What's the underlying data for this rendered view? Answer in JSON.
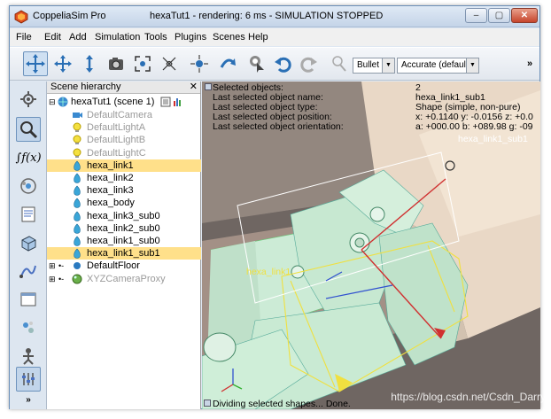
{
  "window": {
    "app_name": "CoppeliaSim Pro",
    "title": "hexaTut1 - rendering: 6 ms - SIMULATION STOPPED",
    "controls": [
      "–",
      "▢",
      "✕"
    ]
  },
  "menu": [
    "File",
    "Edit",
    "Add",
    "Simulation",
    "Tools",
    "Plugins",
    "Scenes",
    "Help"
  ],
  "toolbar": {
    "icons": [
      "object-shift-icon",
      "object-rotate-icon",
      "camera-pan-icon",
      "camera-snapshot-icon",
      "fit-view-icon",
      "camera-fly-icon",
      "assemble-icon",
      "transfer-dna-icon",
      "click-select-icon",
      "undo-icon",
      "redo-icon",
      "light-icon"
    ],
    "engine": "Bullet",
    "accuracy": "Accurate (default)",
    "overflow": "»"
  },
  "sidebar_icons": [
    "model-browser-icon",
    "scene-hierarchy-icon",
    "calculation-modules-icon",
    "collections-icon",
    "scripts-icon",
    "shapes-icon",
    "paths-icon",
    "views-icon",
    "page-selector-icon",
    "scene-selector-icon",
    "simulation-settings-icon",
    "more-icon"
  ],
  "hierarchy": {
    "title": "Scene hierarchy",
    "close": "✕",
    "scene": "hexaTut1 (scene 1)",
    "items": [
      {
        "label": "DefaultCamera",
        "icon": "camera-icon",
        "grey": true,
        "selected": false
      },
      {
        "label": "DefaultLightA",
        "icon": "light-bulb-icon",
        "grey": true,
        "selected": false
      },
      {
        "label": "DefaultLightB",
        "icon": "light-bulb-icon",
        "grey": true,
        "selected": false
      },
      {
        "label": "DefaultLightC",
        "icon": "light-bulb-icon",
        "grey": true,
        "selected": false
      },
      {
        "label": "hexa_link1",
        "icon": "shape-icon",
        "grey": false,
        "selected": true
      },
      {
        "label": "hexa_link2",
        "icon": "shape-icon",
        "grey": false,
        "selected": false
      },
      {
        "label": "hexa_link3",
        "icon": "shape-icon",
        "grey": false,
        "selected": false
      },
      {
        "label": "hexa_body",
        "icon": "shape-icon",
        "grey": false,
        "selected": false
      },
      {
        "label": "hexa_link3_sub0",
        "icon": "shape-icon",
        "grey": false,
        "selected": false
      },
      {
        "label": "hexa_link2_sub0",
        "icon": "shape-icon",
        "grey": false,
        "selected": false
      },
      {
        "label": "hexa_link1_sub0",
        "icon": "shape-icon",
        "grey": false,
        "selected": false
      },
      {
        "label": "hexa_link1_sub1",
        "icon": "shape-icon",
        "grey": false,
        "selected": true
      },
      {
        "label": "DefaultFloor",
        "icon": "dummy-icon",
        "grey": false,
        "selected": false
      },
      {
        "label": "XYZCameraProxy",
        "icon": "sphere-icon",
        "grey": true,
        "selected": false
      }
    ]
  },
  "info": {
    "labels": [
      "Selected objects:",
      "Last selected object name:",
      "Last selected object type:",
      "Last selected object position:",
      "Last selected object orientation:"
    ],
    "values": [
      "2",
      "hexa_link1_sub1",
      "Shape (simple, non-pure)",
      "x: +0.1140    y: -0.0156    z: +0.0",
      "a: +000.00    b: +089.98    g: -09"
    ]
  },
  "viewport_labels": {
    "link1": "hexa_link1",
    "sub1": "hexa_link1_sub1"
  },
  "status": "Dividing selected shapes... Done.",
  "watermark": "https://blog.csdn.net/Csdn_Darry"
}
